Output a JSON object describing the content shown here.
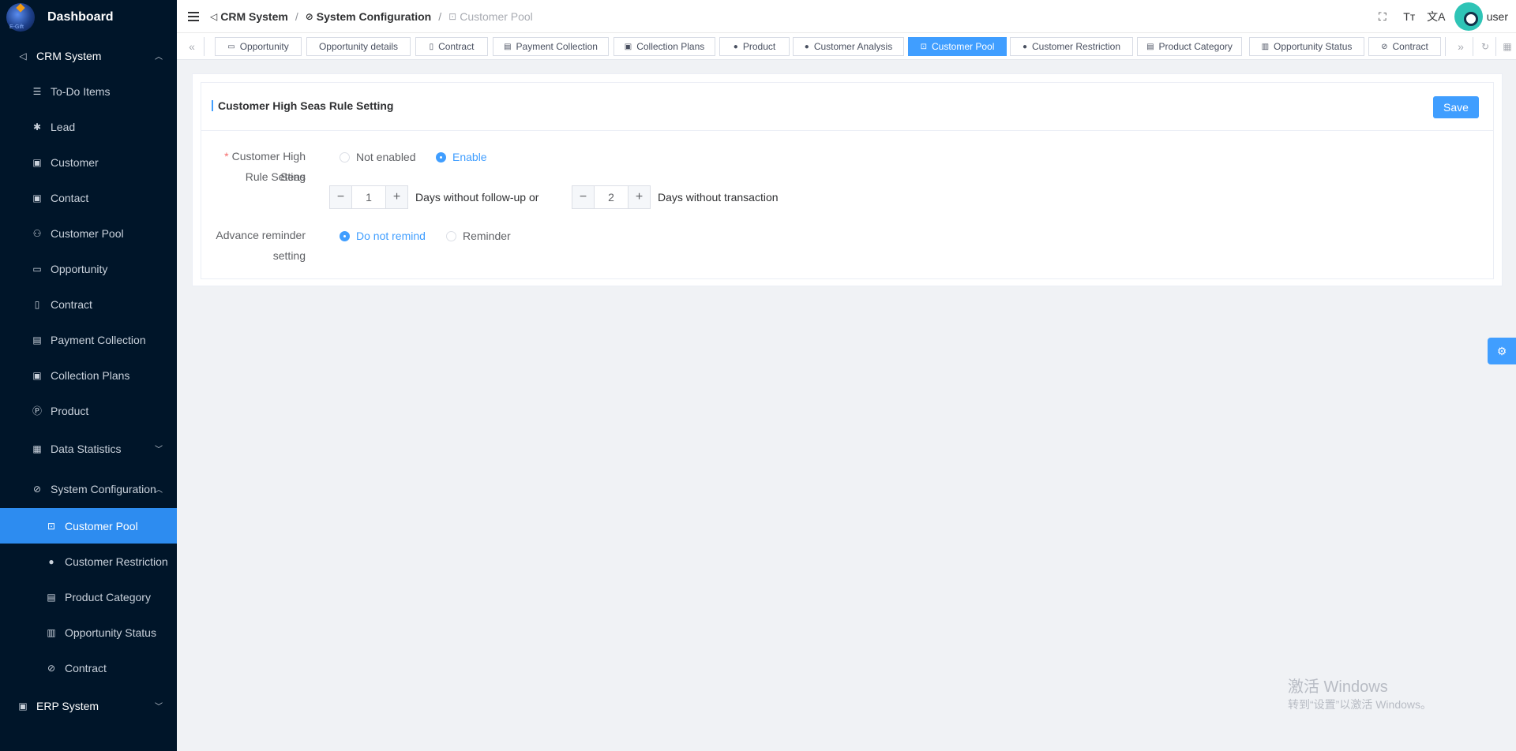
{
  "sidebar": {
    "brand": "Dashboard",
    "logo_sub": "E-Gift",
    "items": [
      {
        "label": "CRM System",
        "icon": "send-icon"
      },
      {
        "label": "To-Do Items",
        "icon": "list-icon"
      },
      {
        "label": "Lead",
        "icon": "leaf-icon"
      },
      {
        "label": "Customer",
        "icon": "id-card-icon"
      },
      {
        "label": "Contact",
        "icon": "contact-icon"
      },
      {
        "label": "Customer Pool",
        "icon": "users-icon"
      },
      {
        "label": "Opportunity",
        "icon": "bus-icon"
      },
      {
        "label": "Contract",
        "icon": "document-icon"
      },
      {
        "label": "Payment Collection",
        "icon": "wallet-icon"
      },
      {
        "label": "Collection Plans",
        "icon": "money-icon"
      },
      {
        "label": "Product",
        "icon": "product-icon"
      },
      {
        "label": "Data Statistics",
        "icon": "chart-icon"
      },
      {
        "label": "System Configuration",
        "icon": "link-icon"
      },
      {
        "label": "Customer Pool",
        "icon": "cart-icon"
      },
      {
        "label": "Customer Restriction",
        "icon": "user-icon"
      },
      {
        "label": "Product Category",
        "icon": "category-icon"
      },
      {
        "label": "Opportunity Status",
        "icon": "status-icon"
      },
      {
        "label": "Contract",
        "icon": "link-icon"
      },
      {
        "label": "ERP System",
        "icon": "erp-icon"
      }
    ]
  },
  "breadcrumb": [
    "CRM System",
    "System Configuration",
    "Customer Pool"
  ],
  "header": {
    "username": "user"
  },
  "tabs": [
    {
      "label": "Opportunity"
    },
    {
      "label": "Opportunity details"
    },
    {
      "label": "Contract"
    },
    {
      "label": "Payment Collection"
    },
    {
      "label": "Collection Plans"
    },
    {
      "label": "Product"
    },
    {
      "label": "Customer Analysis"
    },
    {
      "label": "Customer Pool",
      "active": true
    },
    {
      "label": "Customer Restriction"
    },
    {
      "label": "Product Category"
    },
    {
      "label": "Opportunity Status"
    },
    {
      "label": "Contract"
    }
  ],
  "card": {
    "title": "Customer High Seas Rule Setting",
    "save_label": "Save",
    "rule_label_1": "Customer High Seas",
    "rule_label_2": "Rule Setting",
    "required_mark": "*",
    "rule_options": [
      "Not enabled",
      "Enable"
    ],
    "rule_selected": "Enable",
    "followup_days": "1",
    "followup_text": "Days without follow-up or",
    "transaction_days": "2",
    "transaction_text": "Days without transaction",
    "reminder_label_1": "Advance reminder",
    "reminder_label_2": "setting",
    "reminder_options": [
      "Do not remind",
      "Reminder"
    ],
    "reminder_selected": "Do not remind"
  },
  "watermark": {
    "line1": "激活 Windows",
    "line2": "转到“设置”以激活 Windows。"
  },
  "colors": {
    "primary": "#409eff",
    "sidebar_bg": "#001529",
    "active_menu": "#2d8cf0"
  }
}
